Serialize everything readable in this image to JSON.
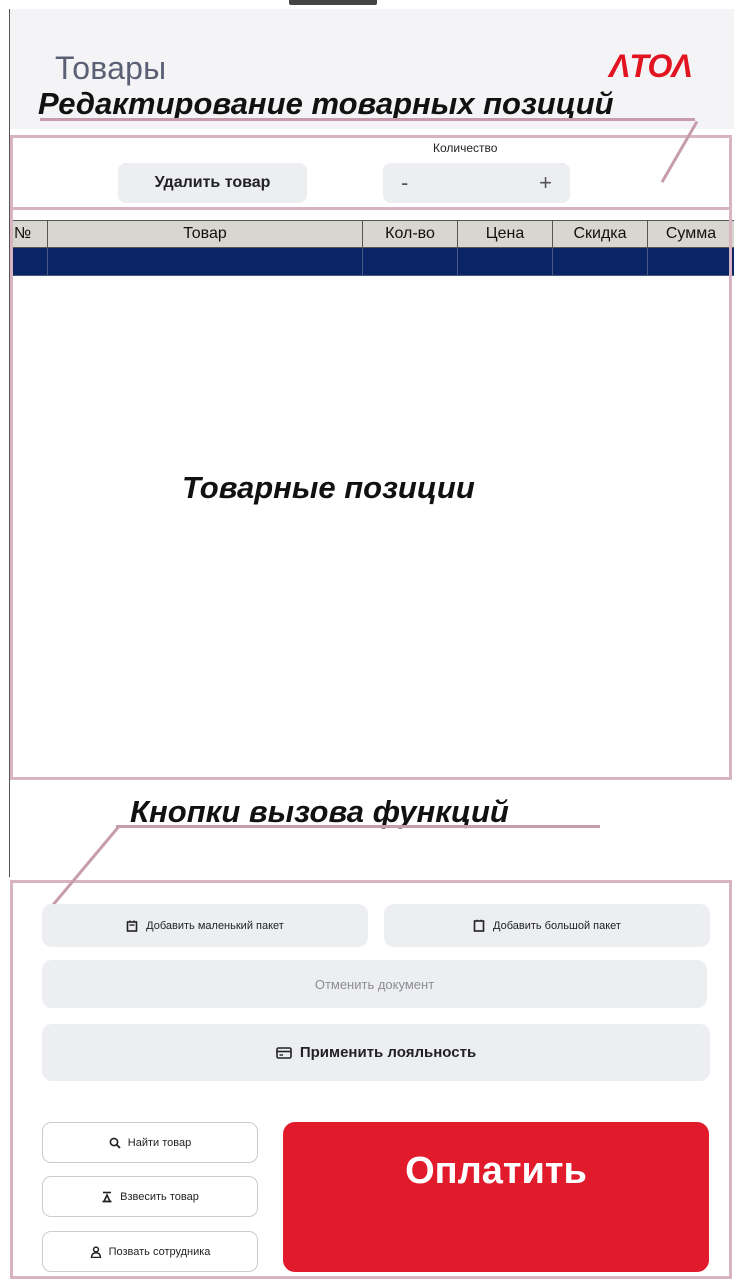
{
  "header": {
    "title": "Товары",
    "logo_text": "ΛТОΛ"
  },
  "annotations": {
    "edit_section": "Редактирование товарных позиций",
    "items_section": "Товарные позиции",
    "functions_section": "Кнопки вызова функций"
  },
  "edit_bar": {
    "delete_label": "Удалить товар",
    "quantity_label": "Количество",
    "minus_label": "-",
    "plus_label": "+"
  },
  "table": {
    "columns": [
      "№",
      "Товар",
      "Кол-во",
      "Цена",
      "Скидка",
      "Сумма"
    ]
  },
  "functions": {
    "small_bag": "Добавить маленький пакет",
    "big_bag": "Добавить большой пакет",
    "cancel_document": "Отменить документ",
    "apply_loyalty": "Применить лояльность",
    "find_item": "Найти товар",
    "weigh_item": "Взвесить товар",
    "call_staff": "Позвать сотрудника",
    "pay": "Оплатить"
  },
  "colors": {
    "brand_red": "#e11b2c",
    "table_selected_row": "#0a2466",
    "annotation_frame": "#d8b3c2"
  },
  "icons": {
    "small_bag": "small-bag-icon",
    "big_bag": "big-bag-icon",
    "loyalty": "card-icon",
    "find": "search-icon",
    "weigh": "scale-icon",
    "call": "person-icon"
  }
}
